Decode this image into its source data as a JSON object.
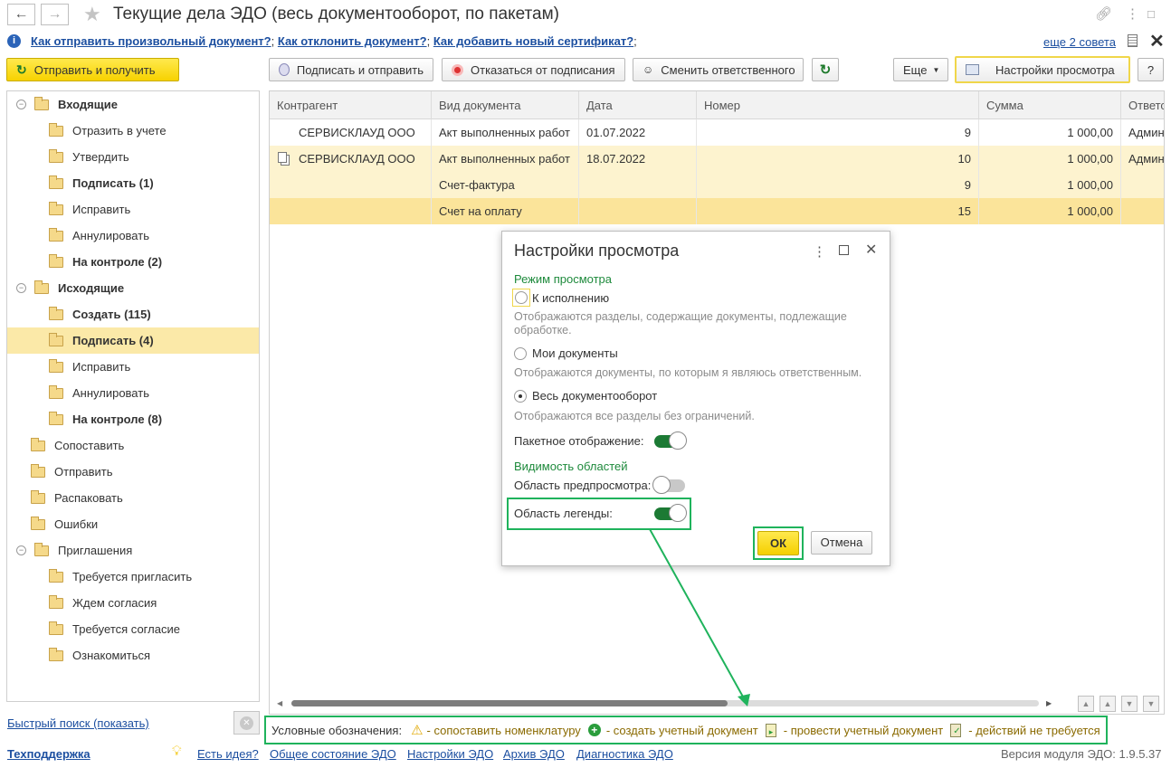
{
  "window": {
    "title": "Текущие дела ЭДО (весь документооборот, по пакетам)"
  },
  "hints": {
    "items": [
      "Как отправить произвольный документ?",
      "Как отклонить документ?",
      "Как добавить новый сертификат?"
    ],
    "more": "еще 2 совета"
  },
  "toolbar": {
    "send_receive": "Отправить и получить",
    "sign_send": "Подписать и отправить",
    "refuse_sign": "Отказаться от подписания",
    "change_resp": "Сменить ответственного",
    "more": "Еще",
    "view_settings": "Настройки просмотра",
    "help": "?"
  },
  "tree": [
    {
      "label": "Входящие",
      "level": 0,
      "bold": true,
      "group": true
    },
    {
      "label": "Отразить в учете",
      "level": 1
    },
    {
      "label": "Утвердить",
      "level": 1
    },
    {
      "label": "Подписать (1)",
      "level": 1,
      "bold": true
    },
    {
      "label": "Исправить",
      "level": 1
    },
    {
      "label": "Аннулировать",
      "level": 1
    },
    {
      "label": "На контроле (2)",
      "level": 1,
      "bold": true
    },
    {
      "label": "Исходящие",
      "level": 0,
      "bold": true,
      "group": true
    },
    {
      "label": "Создать (115)",
      "level": 1,
      "bold": true
    },
    {
      "label": "Подписать (4)",
      "level": 1,
      "bold": true,
      "selected": true
    },
    {
      "label": "Исправить",
      "level": 1
    },
    {
      "label": "Аннулировать",
      "level": 1
    },
    {
      "label": "На контроле (8)",
      "level": 1,
      "bold": true
    },
    {
      "label": "Сопоставить",
      "level": 0
    },
    {
      "label": "Отправить",
      "level": 0
    },
    {
      "label": "Распаковать",
      "level": 0
    },
    {
      "label": "Ошибки",
      "level": 0
    },
    {
      "label": "Приглашения",
      "level": 0,
      "group": true
    },
    {
      "label": "Требуется пригласить",
      "level": 1
    },
    {
      "label": "Ждем согласия",
      "level": 1
    },
    {
      "label": "Требуется согласие",
      "level": 1
    },
    {
      "label": "Ознакомиться",
      "level": 1
    }
  ],
  "table": {
    "columns": [
      "Контрагент",
      "Вид документа",
      "Дата",
      "Номер",
      "Сумма",
      "Ответс"
    ],
    "rows": [
      {
        "counterparty": "СЕРВИСКЛАУД ООО",
        "doc_type": "Акт выполненных работ",
        "date": "01.07.2022",
        "number": "9",
        "sum": "1 000,00",
        "resp": "Админ",
        "package": false,
        "highlight": false
      },
      {
        "counterparty": "СЕРВИСКЛАУД ООО",
        "doc_type": "Акт выполненных работ",
        "date": "18.07.2022",
        "number": "10",
        "sum": "1 000,00",
        "resp": "Админ",
        "package": true,
        "highlight": "light"
      },
      {
        "counterparty": "",
        "doc_type": "Счет-фактура",
        "date": "",
        "number": "9",
        "sum": "1 000,00",
        "resp": "",
        "package": false,
        "highlight": "light"
      },
      {
        "counterparty": "",
        "doc_type": "Счет на оплату",
        "date": "",
        "number": "15",
        "sum": "1 000,00",
        "resp": "",
        "package": false,
        "highlight": "strong"
      }
    ]
  },
  "dialog": {
    "title": "Настройки просмотра",
    "mode_header": "Режим просмотра",
    "opt1": "К исполнению",
    "opt1_desc": "Отображаются разделы, содержащие документы, подлежащие обработке.",
    "opt2": "Мои документы",
    "opt2_desc": "Отображаются документы, по которым я являюсь ответственным.",
    "opt3": "Весь документооборот",
    "opt3_desc": "Отображаются все разделы без ограничений.",
    "selected_option": 3,
    "package_label": "Пакетное отображение:",
    "package_on": true,
    "visibility_header": "Видимость областей",
    "preview_label": "Область предпросмотра:",
    "preview_on": false,
    "legend_label": "Область легенды:",
    "legend_on": true,
    "ok": "ОК",
    "cancel": "Отмена"
  },
  "legend": {
    "title": "Условные обозначения:",
    "items": [
      "- сопоставить номенклатуру",
      "- создать учетный документ",
      "- провести учетный документ",
      "- действий не требуется"
    ]
  },
  "footer": {
    "quick_search": "Быстрый поиск (показать)",
    "support": "Техподдержка",
    "idea": "Есть идея?",
    "links": [
      "Общее состояние ЭДО",
      "Настройки ЭДО",
      "Архив ЭДО",
      "Диагностика ЭДО"
    ],
    "version": "Версия модуля ЭДО: 1.9.5.37"
  },
  "colors": {
    "accent_yellow": "#f7d200",
    "highlight_light": "#fdf3cf",
    "highlight_strong": "#fbe49a",
    "link": "#1c4fa0",
    "green_frame": "#1fb35c",
    "section_green": "#1e8a3c"
  },
  "icons": {
    "back": "arrow-left-icon",
    "forward": "arrow-right-icon",
    "favorite": "star-icon",
    "link": "link-icon",
    "more": "kebab-icon",
    "close": "close-icon"
  }
}
